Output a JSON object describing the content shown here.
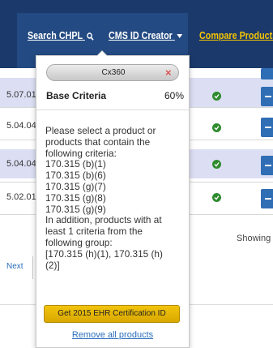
{
  "nav": {
    "search_label": "Search CHPL",
    "search_icon": "search-icon",
    "cms_label": "CMS ID Creator",
    "cms_icon": "caret-down-icon",
    "compare_label": "Compare Products",
    "colors": {
      "bar": "#1b3a6b",
      "active": "#234a82",
      "compare": "#f5c400"
    }
  },
  "table": {
    "rows": [
      {
        "date": "5.07.01",
        "certified": true
      },
      {
        "date": "5.04.04",
        "certified": true
      },
      {
        "date": "5.04.04",
        "certified": true
      },
      {
        "date": "5.02.01",
        "certified": true
      }
    ],
    "showing": "Showing",
    "next": "Next"
  },
  "cms_panel": {
    "product_tag": "Cx360",
    "base_label": "Base Criteria",
    "base_percent": "60%",
    "criteria_lines": [
      "Please select a product or",
      "products that contain the",
      "following criteria:",
      "170.315 (b)(1)",
      "170.315 (b)(6)",
      "170.315 (g)(7)",
      "170.315 (g)(8)",
      "170.315 (g)(9)",
      "In addition, products with at",
      "least 1 criteria from the",
      "following group:",
      "[170.315 (h)(1), 170.315 (h)",
      "(2)]"
    ],
    "get_button": "Get 2015 EHR Certification ID",
    "remove_link": "Remove all products"
  }
}
